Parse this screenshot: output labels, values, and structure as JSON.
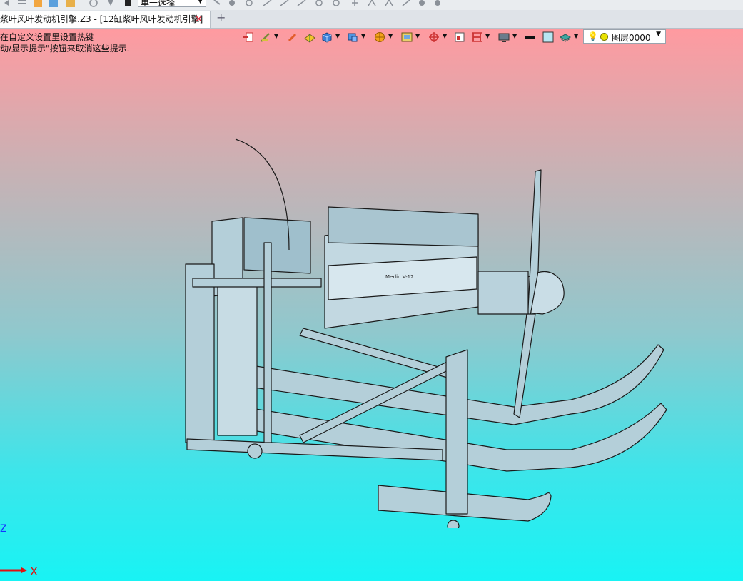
{
  "app": {
    "top_toolbar": {
      "select_mode": "单一选择"
    },
    "tab": {
      "title": "浆叶风叶发动机引擎.Z3 - [12缸浆叶风叶发动机引擎]",
      "close_glyph": "✕"
    },
    "new_tab_glyph": "+"
  },
  "viewport": {
    "hints": [
      "在自定义设置里设置热键",
      "动/显示提示\"按钮来取消这些提示."
    ],
    "view_toolbar": {
      "layer": "图层0000"
    },
    "model": {
      "engine_label": "Merlin V-12"
    },
    "axes": {
      "x_label": "X",
      "z_label": "Z"
    },
    "colors": {
      "background_top": "#ff9aa0",
      "background_bottom": "#18f3f4",
      "model_fill": "#b4cfd9",
      "model_stroke": "#1a1a1a",
      "axis_x": "#e01010",
      "axis_z": "#1436ff"
    }
  }
}
